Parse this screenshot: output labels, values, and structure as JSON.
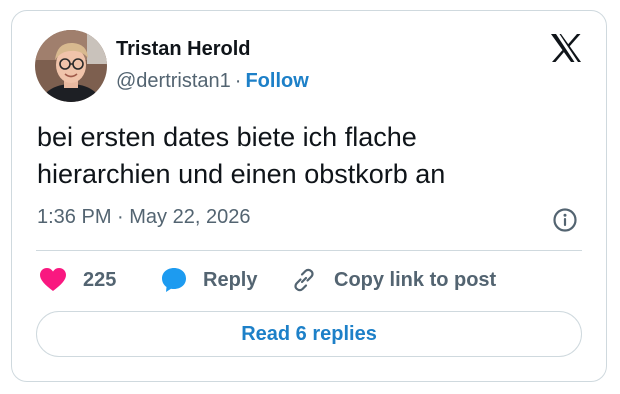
{
  "author": {
    "name": "Tristan Herold",
    "handle": "@dertristan1",
    "separator": "·",
    "follow_label": "Follow"
  },
  "tweet": {
    "text_line1": "bei ersten dates biete ich flache",
    "text_line2": "hierarchien und einen obstkorb an",
    "timestamp": "1:36 PM · May 22, 2026"
  },
  "actions": {
    "like_count": "225",
    "reply_label": "Reply",
    "copy_link_label": "Copy link to post"
  },
  "read_replies_label": "Read 6 replies",
  "icons": {
    "brand": "x-logo-icon",
    "info": "info-icon",
    "like": "heart-icon",
    "reply": "speech-bubble-icon",
    "copy": "link-icon"
  },
  "colors": {
    "text_primary": "#0f1419",
    "text_secondary": "#536471",
    "link_blue": "#1d80c8",
    "like_pink": "#f91880",
    "reply_blue": "#1d9bf0",
    "border": "#cfd9de"
  }
}
